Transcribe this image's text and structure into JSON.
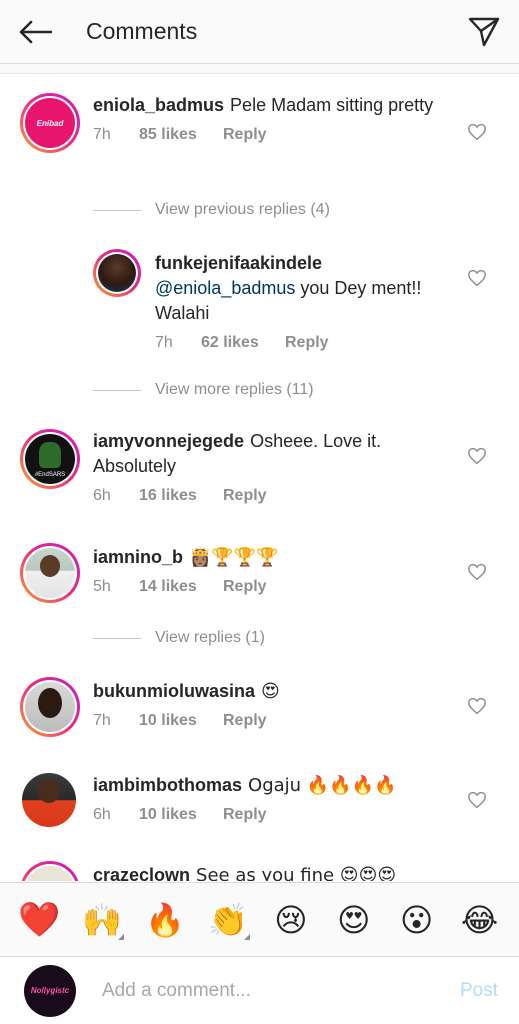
{
  "header": {
    "title": "Comments",
    "back_icon": "arrow-left-icon",
    "share_icon": "paper-plane-icon"
  },
  "comments": [
    {
      "username": "eniola_badmus",
      "text": "Pele Madam sitting pretty",
      "time": "7h",
      "likes": "85 likes",
      "reply": "Reply",
      "avatar_label": "Enibad"
    },
    {
      "username": "funkejenifaakindele",
      "mention": "@eniola_badmus",
      "text": " you Dey ment!! Walahi",
      "time": "7h",
      "likes": "62 likes",
      "reply": "Reply"
    },
    {
      "username": "iamyvonnejegede",
      "text": "Osheee. Love it. Absolutely",
      "time": "6h",
      "likes": "16 likes",
      "reply": "Reply",
      "avatar_label": "#EndSARS"
    },
    {
      "username": "iamnino_b",
      "text": "👸🏽🏆🏆🏆",
      "time": "5h",
      "likes": "14 likes",
      "reply": "Reply"
    },
    {
      "username": "bukunmioluwasina",
      "text": "😍",
      "time": "7h",
      "likes": "10 likes",
      "reply": "Reply"
    },
    {
      "username": "iambimbothomas",
      "text": "Ogaju 🔥🔥🔥🔥",
      "time": "6h",
      "likes": "10 likes",
      "reply": "Reply"
    },
    {
      "username": "crazeclown",
      "text": "See as you fine 😍😍😍"
    }
  ],
  "view_previous": "View previous replies (4)",
  "view_more": "View more replies (11)",
  "view_replies": "View replies (1)",
  "emoji_bar": [
    "❤️",
    "🙌",
    "🔥",
    "👏",
    "😢",
    "😍",
    "😮",
    "😂"
  ],
  "composer": {
    "placeholder": "Add a comment...",
    "post_label": "Post",
    "avatar_label": "Nollygistc"
  },
  "colors": {
    "text": "#262626",
    "muted": "#8e8e8e",
    "mention": "#003569",
    "post_disabled": "#b3dbff"
  }
}
